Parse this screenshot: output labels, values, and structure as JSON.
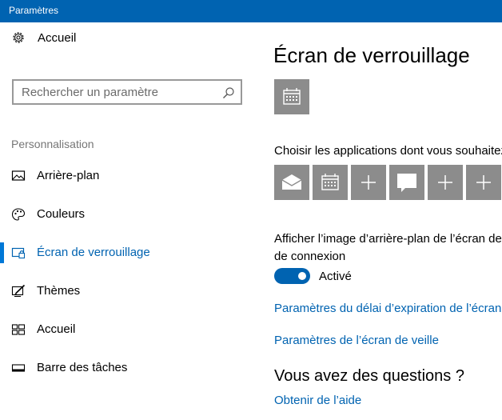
{
  "window": {
    "title": "Paramètres"
  },
  "nav": {
    "home_label": "Accueil",
    "search_placeholder": "Rechercher un paramètre",
    "section_label": "Personnalisation",
    "items": [
      {
        "label": "Arrière-plan",
        "icon": "picture-icon",
        "selected": false
      },
      {
        "label": "Couleurs",
        "icon": "palette-icon",
        "selected": false
      },
      {
        "label": "Écran de verrouillage",
        "icon": "lock-screen-icon",
        "selected": true
      },
      {
        "label": "Thèmes",
        "icon": "themes-icon",
        "selected": false
      },
      {
        "label": "Accueil",
        "icon": "start-tiles-icon",
        "selected": false
      },
      {
        "label": "Barre des tâches",
        "icon": "taskbar-icon",
        "selected": false
      }
    ]
  },
  "main": {
    "title": "Écran de verrouillage",
    "detail_app_icon": "calendar-icon",
    "quick_status_label": "Choisir les applications dont vous souhaitez",
    "quick_apps": [
      {
        "icon": "mail-icon"
      },
      {
        "icon": "calendar-icon"
      },
      {
        "icon": "plus-icon"
      },
      {
        "icon": "message-icon"
      },
      {
        "icon": "plus-icon"
      },
      {
        "icon": "plus-icon"
      }
    ],
    "background_label_line1": "Afficher l’image d’arrière-plan de l’écran de",
    "background_label_line2": "de connexion",
    "toggle_state": "Activé",
    "link_timeout": "Paramètres du délai d’expiration de l’écran",
    "link_screensaver": "Paramètres de l’écran de veille",
    "questions_heading": "Vous avez des questions ?",
    "help_link": "Obtenir de l’aide"
  },
  "colors": {
    "accent": "#0063b1",
    "tile": "#8c8c8c",
    "titlebar": "#0063b1"
  }
}
